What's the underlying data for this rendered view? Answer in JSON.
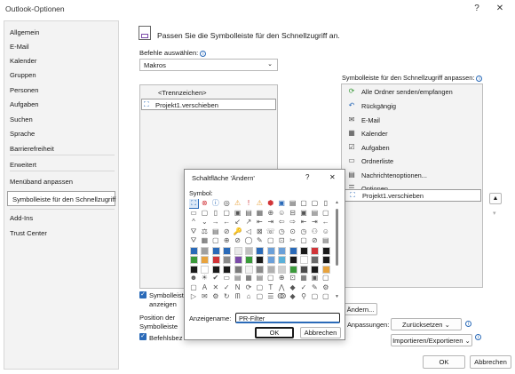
{
  "window": {
    "title": "Outlook-Optionen",
    "help_icon": "?",
    "close_icon": "✕"
  },
  "nav": {
    "items": [
      {
        "label": "Allgemein"
      },
      {
        "label": "E-Mail"
      },
      {
        "label": "Kalender"
      },
      {
        "label": "Gruppen"
      },
      {
        "label": "Personen"
      },
      {
        "label": "Aufgaben"
      },
      {
        "label": "Suchen"
      },
      {
        "label": "Sprache"
      },
      {
        "label": "Barrierefreiheit"
      },
      {
        "label": "Erweitert"
      },
      {
        "label": "Menüband anpassen"
      },
      {
        "label": "Symbolleiste für den Schnellzugriff"
      },
      {
        "label": "Add-Ins"
      },
      {
        "label": "Trust Center"
      }
    ],
    "selected": "Symbolleiste für den Schnellzugriff"
  },
  "main": {
    "heading": "Passen Sie die Symbolleiste für den Schnellzugriff an.",
    "commands_label": "Befehle auswählen:",
    "commands_value": "Makros",
    "left_list": [
      "<Trennzeichen>",
      "Projekt1.verschieben"
    ],
    "qa_label": "Symbolleiste für den Schnellzugriff anpassen:",
    "qa_items": [
      {
        "icon": "refresh-icon",
        "label": "Alle Ordner senden/empfangen"
      },
      {
        "icon": "undo-icon",
        "label": "Rückgängig"
      },
      {
        "icon": "mail-icon",
        "label": "E-Mail"
      },
      {
        "icon": "calendar-icon",
        "label": "Kalender"
      },
      {
        "icon": "task-icon",
        "label": "Aufgaben"
      },
      {
        "icon": "folder-list-icon",
        "label": "Ordnerliste"
      },
      {
        "icon": "message-options-icon",
        "label": "Nachrichtenoptionen..."
      },
      {
        "icon": "options-icon",
        "label": "Optionen"
      },
      {
        "icon": "macro-icon",
        "label": "Projekt1.verschieben"
      }
    ],
    "show_qa_label_1": "Symbolleiste",
    "show_qa_label_2": "anzeigen",
    "position_label_1": "Position der",
    "position_label_2": "Symbolleiste",
    "commands_labels_label": "Befehlsbez",
    "aendern_button": "Ändern...",
    "anpassungen_label": "Anpassungen:",
    "zuruecksetzen_button": "Zurücksetzen",
    "import_export_button": "Importieren/Exportieren",
    "ok_button": "OK",
    "cancel_button": "Abbrechen"
  },
  "dialog": {
    "title": "Schaltfläche 'Ändern'",
    "help": "?",
    "close": "✕",
    "symbol_label": "Symbol:",
    "display_name_label": "Anzeigename:",
    "display_name_value": "PR-Filter",
    "ok_button": "OK",
    "cancel_button": "Abbrechen"
  },
  "colors": {
    "accent": "#2a6ab8",
    "nav_bg": "#f3f3f3",
    "red": "#d13438",
    "orange": "#e8a33d",
    "green": "#3a9a3a"
  }
}
